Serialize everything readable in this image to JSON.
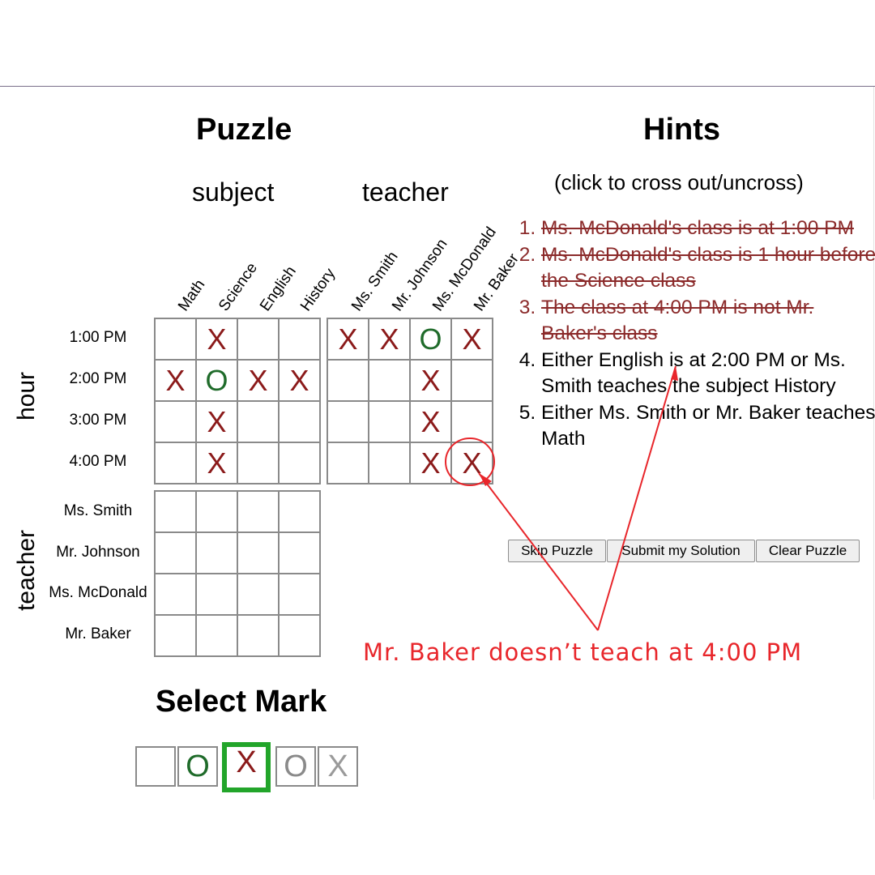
{
  "puzzle": {
    "title": "Puzzle",
    "group_subject": "subject",
    "group_teacher": "teacher",
    "side_hour": "hour",
    "side_teacher": "teacher",
    "columns": [
      "Math",
      "Science",
      "English",
      "History",
      "Ms. Smith",
      "Mr. Johnson",
      "Ms. McDonald",
      "Mr. Baker"
    ],
    "hour_rows": [
      "1:00 PM",
      "2:00 PM",
      "3:00 PM",
      "4:00 PM"
    ],
    "teacher_rows": [
      "Ms. Smith",
      "Mr. Johnson",
      "Ms. McDonald",
      "Mr. Baker"
    ],
    "hour_subject_marks": [
      [
        "",
        "X",
        "",
        ""
      ],
      [
        "X",
        "O",
        "X",
        "X"
      ],
      [
        "",
        "X",
        "",
        ""
      ],
      [
        "",
        "X",
        "",
        ""
      ]
    ],
    "hour_teacher_marks": [
      [
        "X",
        "X",
        "O",
        "X"
      ],
      [
        "",
        "",
        "X",
        ""
      ],
      [
        "",
        "",
        "X",
        ""
      ],
      [
        "",
        "",
        "X",
        "X"
      ]
    ],
    "teacher_subject_marks": [
      [
        "",
        "",
        "",
        ""
      ],
      [
        "",
        "",
        "",
        ""
      ],
      [
        "",
        "",
        "",
        ""
      ],
      [
        "",
        "",
        "",
        ""
      ]
    ]
  },
  "hints": {
    "title": "Hints",
    "subtitle": "(click to cross out/uncross)",
    "items": [
      {
        "text": "Ms. McDonald's class is at 1:00 PM",
        "crossed": true
      },
      {
        "text": "Ms. McDonald's class is 1 hour before the Science class",
        "crossed": true
      },
      {
        "text": "The class at 4:00 PM is not Mr. Baker's class",
        "crossed": true
      },
      {
        "text": "Either English is at 2:00 PM or Ms. Smith teaches the subject History",
        "crossed": false
      },
      {
        "text": "Either Ms. Smith or Mr. Baker teaches Math",
        "crossed": false
      }
    ]
  },
  "buttons": {
    "skip": "Skip Puzzle",
    "submit": "Submit my Solution",
    "clear": "Clear Puzzle"
  },
  "select_mark": {
    "title": "Select Mark",
    "options": [
      "",
      "O",
      "X",
      "O",
      "X"
    ],
    "selected_index": 2
  },
  "annotation": {
    "text": "Mr. Baker doesn’t teach at 4:00 PM",
    "color": "#e8262b"
  },
  "colors": {
    "x_mark": "#8b1a1a",
    "o_mark": "#1f6b2a",
    "selected_border": "#22a52a"
  }
}
